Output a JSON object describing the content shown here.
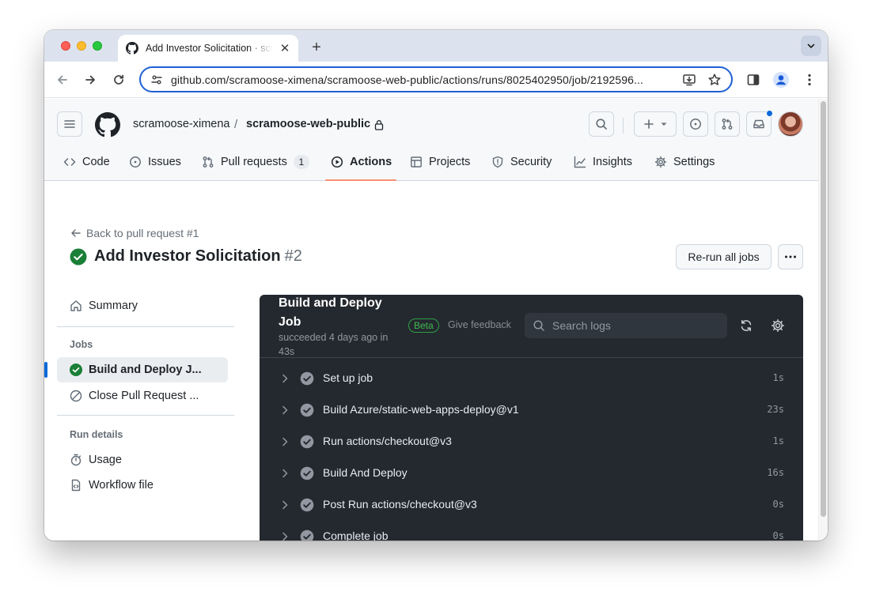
{
  "browser": {
    "tab_title": "Add Investor Solicitation · scramoose-ximena/scramoose-web-public",
    "url": "github.com/scramoose-ximena/scramoose-web-public/actions/runs/8025402950/job/2192596..."
  },
  "header": {
    "owner": "scramoose-ximena",
    "separator": "/",
    "repo": "scramoose-web-public"
  },
  "nav": {
    "code": "Code",
    "issues": "Issues",
    "pull_requests": "Pull requests",
    "pull_requests_count": "1",
    "actions": "Actions",
    "projects": "Projects",
    "security": "Security",
    "insights": "Insights",
    "settings": "Settings",
    "active": "Actions"
  },
  "run": {
    "back_link": "Back to pull request #1",
    "title": "Add Investor Solicitation",
    "number": "#2",
    "rerun_label": "Re-run all jobs"
  },
  "sidebar": {
    "summary": "Summary",
    "jobs_heading": "Jobs",
    "jobs": [
      {
        "label": "Build and Deploy J...",
        "status": "success"
      },
      {
        "label": "Close Pull Request ...",
        "status": "skipped"
      }
    ],
    "run_details_heading": "Run details",
    "usage": "Usage",
    "workflow_file": "Workflow file"
  },
  "log": {
    "job_name": "Build and Deploy Job",
    "status_text": "succeeded 4 days ago in 43s",
    "beta": "Beta",
    "feedback": "Give feedback",
    "search_placeholder": "Search logs",
    "steps": [
      {
        "name": "Set up job",
        "duration": "1s"
      },
      {
        "name": "Build Azure/static-web-apps-deploy@v1",
        "duration": "23s"
      },
      {
        "name": "Run actions/checkout@v3",
        "duration": "1s"
      },
      {
        "name": "Build And Deploy",
        "duration": "16s"
      },
      {
        "name": "Post Run actions/checkout@v3",
        "duration": "0s"
      },
      {
        "name": "Complete job",
        "duration": "0s"
      }
    ]
  },
  "colors": {
    "success": "#1a7f37",
    "accent_underline": "#fd8c73",
    "selected_indicator": "#0969da",
    "log_bg": "#24292f"
  }
}
